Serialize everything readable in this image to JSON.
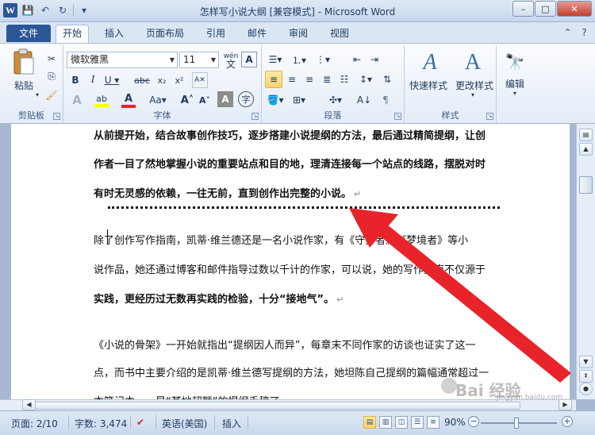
{
  "window": {
    "title": "怎样写小说大纲 [兼容模式] - Microsoft Word",
    "app_letter": "W",
    "minimize": "–",
    "maximize": "□",
    "close": "✕"
  },
  "qat": {
    "save_icon": "💾",
    "undo_icon": "↶",
    "redo_icon": "↻",
    "customize_icon": "▾"
  },
  "tabs": {
    "file": "文件",
    "items": [
      "开始",
      "插入",
      "页面布局",
      "引用",
      "邮件",
      "审阅",
      "视图"
    ],
    "active": "开始",
    "help_icon": "?",
    "minimize_ribbon_icon": "⌃"
  },
  "ribbon": {
    "clipboard": {
      "paste": "粘贴",
      "label": "剪贴板"
    },
    "font": {
      "name": "微软雅黑",
      "size": "11",
      "label": "字体",
      "phonetic": "wén"
    },
    "paragraph": {
      "label": "段落"
    },
    "styles": {
      "quick": "快速样式",
      "change": "更改样式",
      "label": "样式"
    },
    "editing": {
      "label": "编辑"
    }
  },
  "document": {
    "lines": [
      "从前提开始，结合故事创作技巧，逐步搭建小说提纲的方法，最后通过精简提纲，让创",
      "作者一目了然地掌握小说的重要站点和目的地，理清连接每一个站点的线路，摆脱对时",
      "有时无灵感的依赖，一往无前，直到创作出完整的小说。",
      "除了创作写作指南，凯蒂·维兰德还是一名小说作家，有《守护者》、《梦境者》等小",
      "说作品，她还通过博客和邮件指导过数以千计的作家，可以说，她的写作指南不仅源于",
      "实践，更经历过无数再实践的检验，十分“接地气”。",
      "《小说的骨架》一开始就指出“提纲因人而异”，每章末不同作家的访谈也证实了这一",
      "点，而书中主要介绍的是凯蒂·维兰德写提纲的方法，她坦陈自己提纲的篇幅通常超过一",
      "本笔记本……是“某地超额”的提纲手稿了"
    ],
    "para_mark": "↵"
  },
  "status": {
    "page": "页面: 2/10",
    "words": "字数: 3,474",
    "language": "英语(美国)",
    "insert": "插入",
    "zoom": "90%"
  },
  "watermark": {
    "text": "Bai 经验",
    "url": "jingyan.baidu.com"
  },
  "colors": {
    "accent": "#2b5797",
    "arrow": "#e8232a"
  }
}
